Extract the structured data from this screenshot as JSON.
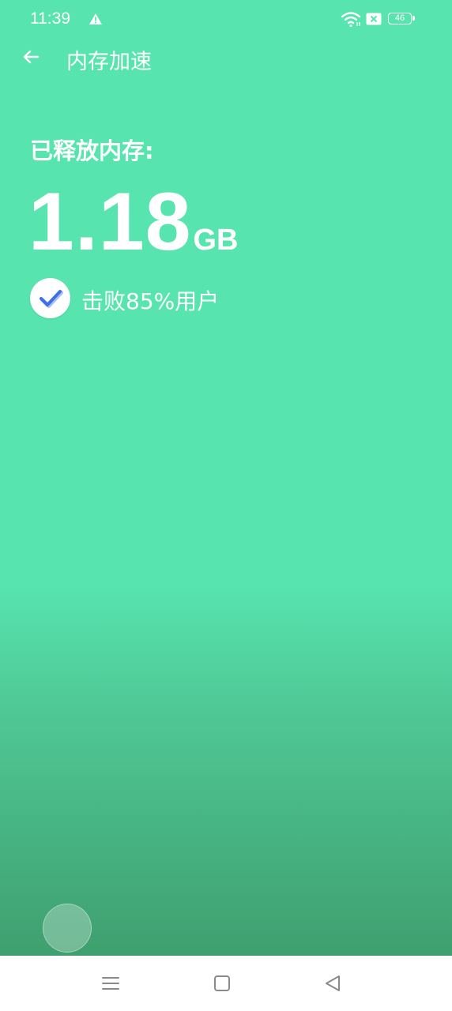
{
  "status_bar": {
    "time": "11:39",
    "battery": "46",
    "icons": [
      "warning-icon",
      "wifi-icon",
      "sim-card-icon",
      "battery-icon"
    ]
  },
  "header": {
    "back_icon": "arrow-left-icon",
    "title": "内存加速"
  },
  "result": {
    "freed_label": "已释放内存:",
    "freed_value": "1.18",
    "freed_unit": "GB",
    "check_icon": "checkmark-icon",
    "beat_text": "击败85%用户"
  },
  "nav_bar": {
    "icons": [
      "menu-icon",
      "home-square-icon",
      "back-triangle-icon"
    ]
  },
  "colors": {
    "background_top": "#57e4ae",
    "background_bottom": "#3f9f6f",
    "check_blue": "#3f6fe8",
    "nav_icon": "#8a8a8a"
  }
}
